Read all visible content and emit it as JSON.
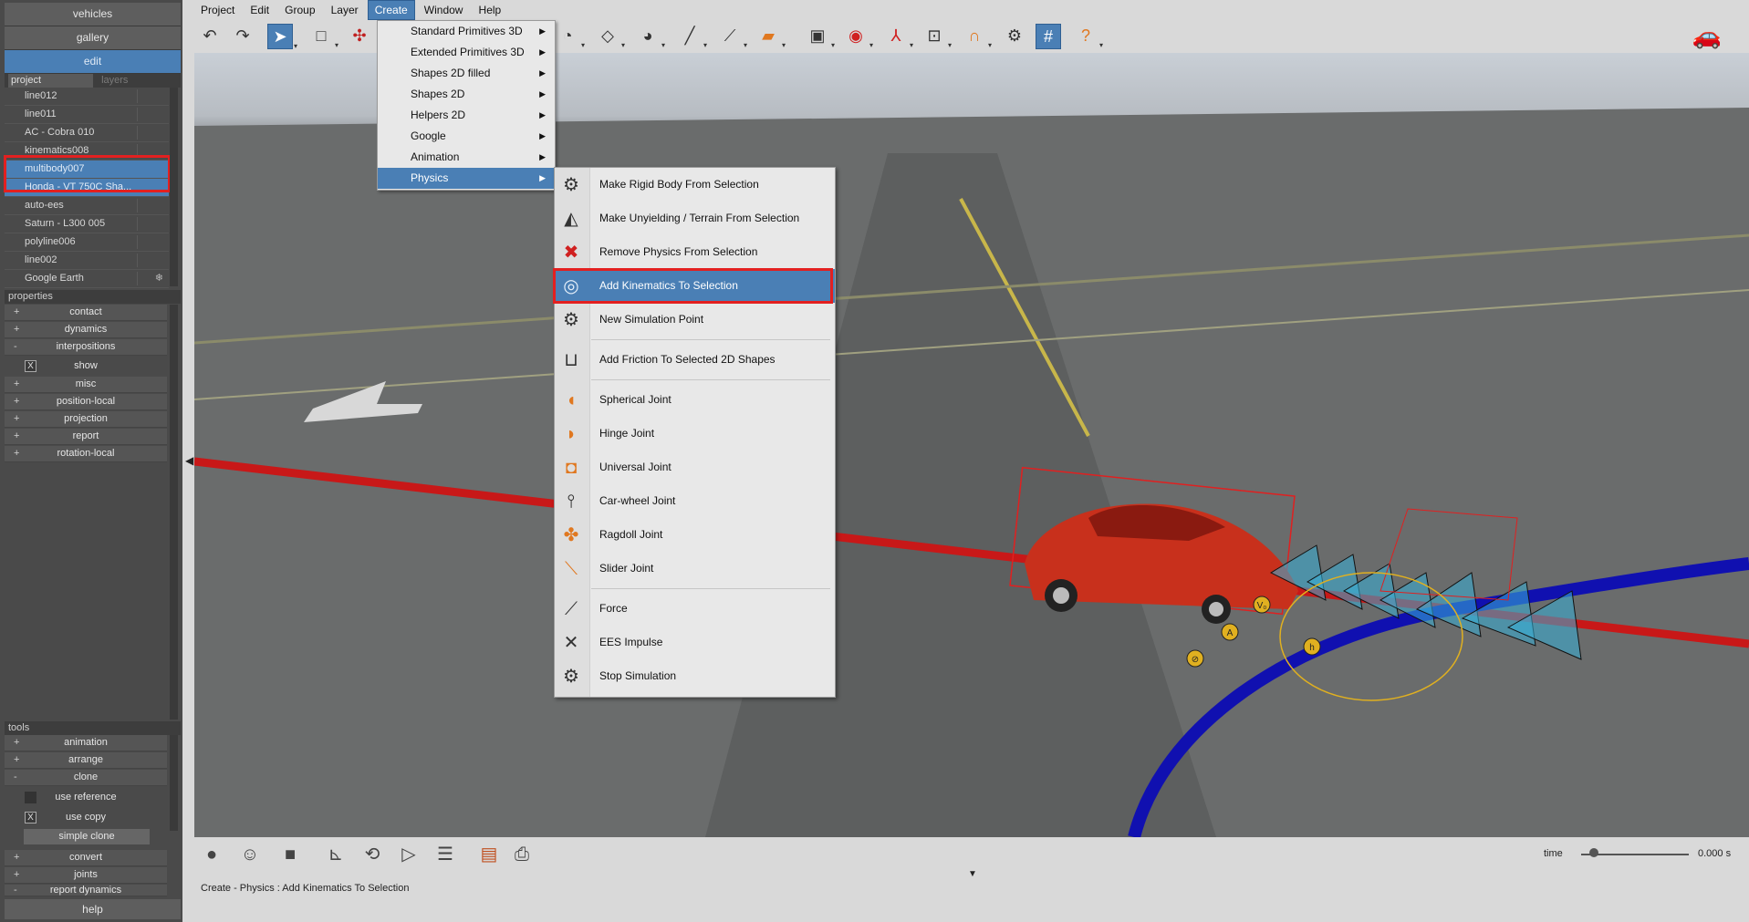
{
  "left_panel": {
    "buttons": {
      "vehicles": "vehicles",
      "gallery": "gallery",
      "edit": "edit"
    },
    "project_header": {
      "project": "project",
      "layers": "layers"
    },
    "project_items": [
      {
        "label": "line012",
        "selected": false
      },
      {
        "label": "line011",
        "selected": false
      },
      {
        "label": "AC - Cobra 010",
        "selected": false
      },
      {
        "label": "kinematics008",
        "selected": false
      },
      {
        "label": "multibody007",
        "selected": true
      },
      {
        "label": "Honda - VT 750C Sha...",
        "selected": true
      },
      {
        "label": "auto-ees",
        "selected": false
      },
      {
        "label": "Saturn - L300 005",
        "selected": false
      },
      {
        "label": "polyline006",
        "selected": false
      },
      {
        "label": "line002",
        "selected": false
      },
      {
        "label": "Google Earth",
        "selected": false
      }
    ],
    "properties_header": "properties",
    "properties": [
      {
        "pm": "+",
        "label": "contact"
      },
      {
        "pm": "+",
        "label": "dynamics"
      },
      {
        "pm": "-",
        "label": "interpositions"
      }
    ],
    "show_checkbox": {
      "label": "show",
      "mark": "X"
    },
    "properties2": [
      {
        "pm": "+",
        "label": "misc"
      },
      {
        "pm": "+",
        "label": "position-local"
      },
      {
        "pm": "+",
        "label": "projection"
      },
      {
        "pm": "+",
        "label": "report"
      },
      {
        "pm": "+",
        "label": "rotation-local"
      }
    ],
    "tools_header": "tools",
    "tools": [
      {
        "pm": "+",
        "label": "animation"
      },
      {
        "pm": "+",
        "label": "arrange"
      },
      {
        "pm": "-",
        "label": "clone"
      }
    ],
    "use_reference": {
      "label": "use reference",
      "mark": ""
    },
    "use_copy": {
      "label": "use copy",
      "mark": "X"
    },
    "simple_clone": "simple clone",
    "tools2": [
      {
        "pm": "+",
        "label": "convert"
      },
      {
        "pm": "+",
        "label": "joints"
      },
      {
        "pm": "-",
        "label": "report dynamics"
      }
    ],
    "help": "help"
  },
  "menubar": [
    "Project",
    "Edit",
    "Group",
    "Layer",
    "Create",
    "Window",
    "Help"
  ],
  "create_menu": [
    {
      "label": "Standard Primitives 3D"
    },
    {
      "label": "Extended Primitives 3D"
    },
    {
      "label": "Shapes 2D filled"
    },
    {
      "label": "Shapes 2D"
    },
    {
      "label": "Helpers 2D"
    },
    {
      "label": "Google"
    },
    {
      "label": "Animation"
    },
    {
      "label": "Physics"
    }
  ],
  "physics_menu": [
    {
      "label": "Make Rigid Body From Selection",
      "icon": "gears-icon"
    },
    {
      "label": "Make Unyielding / Terrain From Selection",
      "icon": "terrain-icon"
    },
    {
      "label": "Remove Physics From Selection",
      "icon": "remove-physics-icon"
    },
    {
      "label": "Add Kinematics To Selection",
      "icon": "kinematics-icon"
    },
    {
      "label": "New Simulation Point",
      "icon": "simulation-point-icon"
    },
    {
      "label": "Add Friction To Selected 2D Shapes",
      "icon": "friction-icon"
    },
    {
      "label": "Spherical Joint",
      "icon": "spherical-joint-icon"
    },
    {
      "label": "Hinge Joint",
      "icon": "hinge-joint-icon"
    },
    {
      "label": "Universal Joint",
      "icon": "universal-joint-icon"
    },
    {
      "label": "Car-wheel Joint",
      "icon": "car-wheel-joint-icon"
    },
    {
      "label": "Ragdoll Joint",
      "icon": "ragdoll-joint-icon"
    },
    {
      "label": "Slider Joint",
      "icon": "slider-joint-icon"
    },
    {
      "label": "Force",
      "icon": "force-icon"
    },
    {
      "label": "EES Impulse",
      "icon": "ees-impulse-icon"
    },
    {
      "label": "Stop Simulation",
      "icon": "stop-simulation-icon"
    }
  ],
  "status": "Create - Physics : Add Kinematics To Selection",
  "time": {
    "label": "time",
    "value": "0.000 s",
    "slider_position": 0.12
  },
  "viewport_markers": {
    "v0": "V₀",
    "a": "A",
    "h": "h",
    "x": "⊘"
  }
}
